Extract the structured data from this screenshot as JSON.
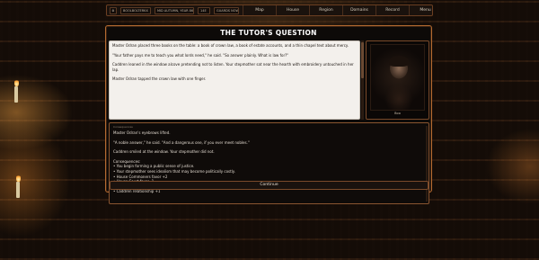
{
  "topbar": {
    "chip_icon": "⚙",
    "name": "BOOLBOLTERKX",
    "date": "MID AUTUMN, YEAR 860",
    "age": "14E",
    "status": "GUARDS NOW",
    "nav": [
      "Map",
      "House",
      "Region",
      "Domains",
      "Record",
      "Menu"
    ]
  },
  "event": {
    "title": "THE TUTOR'S QUESTION",
    "story": [
      "Master Odran placed three books on the table: a book of crown law, a book of estate accounts, and a thin chapel text about mercy.",
      "\"Your father pays me to teach you what lords need,\" he said. \"So answer plainly. What is law for?\"",
      "Caddren leaned in the window alcove pretending not to listen. Your stepmother sat near the hearth with embroidery untouched in her lap.",
      "Master Odran tapped the crown law with one finger."
    ],
    "portrait_name": "Boo",
    "outcome_header": "Consequences",
    "outcome": [
      "Master Odran's eyebrows lifted.",
      "\"A noble answer,\" he said. \"And a dangerous one, if you ever meet nobles.\"",
      "Caddren smiled at the window. Your stepmother did not."
    ],
    "consequences_title": "Consequences:",
    "consequences": [
      "You begin forming a public sense of justice.",
      "Your stepmother sees idealism that may become politically costly.",
      "House Commoners favor +2",
      "House Court favor -1",
      "Stepmother relationship -1",
      "Caddren relationship +1"
    ],
    "continue_label": "Continue"
  },
  "icons": {
    "settings": "gear-icon"
  },
  "colors": {
    "accent_border": "#b36a30",
    "story_bg": "#f3f0ec"
  }
}
